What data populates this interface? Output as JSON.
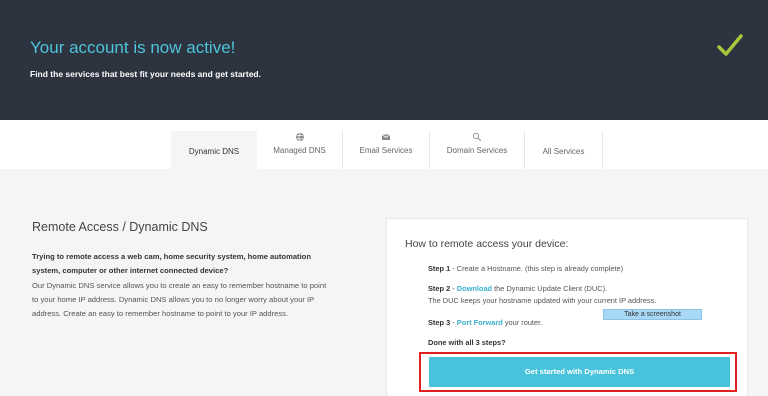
{
  "hero": {
    "title": "Your account is now active!",
    "subtitle": "Find the services that best fit your needs and get started.",
    "check_color": "#a6c83a"
  },
  "tabs": [
    {
      "label": "Dynamic DNS",
      "icon": "none",
      "active": true
    },
    {
      "label": "Managed DNS",
      "icon": "globe-icon",
      "active": false
    },
    {
      "label": "Email Services",
      "icon": "envelope-icon",
      "active": false
    },
    {
      "label": "Domain Services",
      "icon": "magnifier-icon",
      "active": false
    },
    {
      "label": "All Services",
      "icon": "none",
      "active": false
    }
  ],
  "left": {
    "title": "Remote Access / Dynamic DNS",
    "question": "Trying to remote access a web cam, home security system, home automation system, computer or other internet connected device?",
    "body": "Our Dynamic DNS service allows you to create an easy to remember hostname to point to your home IP address. Dynamic DNS allows you to no longer worry about your IP address. Create an easy to remember hostname to point to your IP address."
  },
  "card": {
    "title": "How to remote access your device:",
    "step1_label": "Step 1",
    "step1_text": " - Create a Hostname. (this step is already complete)",
    "step2_label": "Step 2",
    "step2_pre": " - ",
    "step2_link": "Download",
    "step2_text": " the Dynamic Update Client (DUC).",
    "step2_line2": "The DUC keeps your hostname updated with your current IP address.",
    "step3_label": "Step 3",
    "step3_pre": " - ",
    "step3_link": "Port Forward",
    "step3_text": " your router.",
    "done": "Done with all 3 steps?",
    "cta": "Get started with Dynamic DNS"
  },
  "tooltip": "Take a screenshot",
  "colors": {
    "hero_bg": "#2d3440",
    "accent": "#4ec3d9",
    "cta_bg": "#49c3dc",
    "highlight_frame": "#e02020"
  }
}
